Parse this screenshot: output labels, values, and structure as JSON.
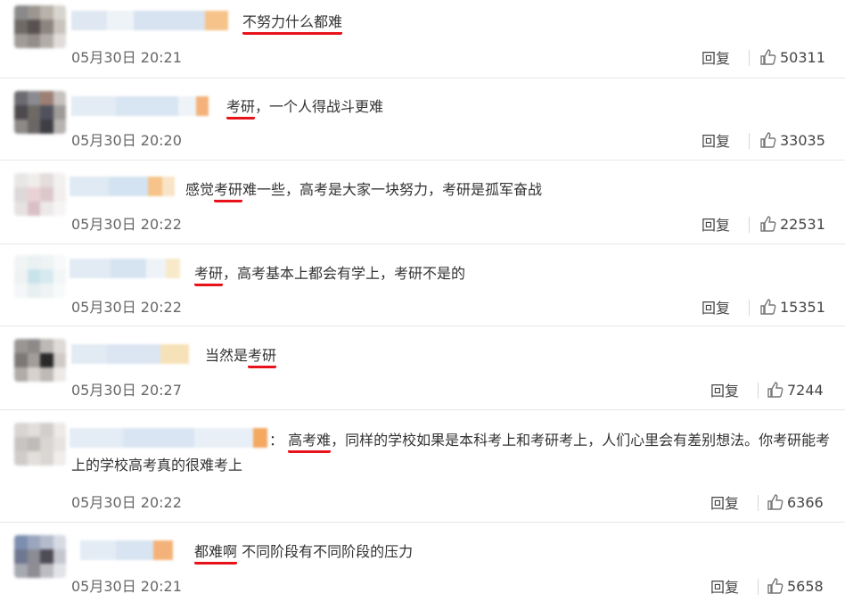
{
  "comments": [
    {
      "text_parts": [
        {
          "t": "不努力什么都难",
          "u": true
        }
      ],
      "time": "05月30日 20:21",
      "reply": "回复",
      "likes": "50311"
    },
    {
      "text_parts": [
        {
          "t": "考研",
          "u": true
        },
        {
          "t": "，一个人得战斗更难",
          "u": false
        }
      ],
      "time": "05月30日 20:20",
      "reply": "回复",
      "likes": "33035"
    },
    {
      "text_parts": [
        {
          "t": "感觉",
          "u": false
        },
        {
          "t": "考研",
          "u": true
        },
        {
          "t": "难一些，高考是大家一块努力，考研是孤军奋战",
          "u": false
        }
      ],
      "time": "05月30日 20:22",
      "reply": "回复",
      "likes": "22531"
    },
    {
      "text_parts": [
        {
          "t": "考研",
          "u": true
        },
        {
          "t": "，高考基本上都会有学上，考研不是的",
          "u": false
        }
      ],
      "time": "05月30日 20:22",
      "reply": "回复",
      "likes": "15351"
    },
    {
      "text_parts": [
        {
          "t": "当然是",
          "u": false
        },
        {
          "t": "考研",
          "u": true
        }
      ],
      "time": "05月30日 20:27",
      "reply": "回复",
      "likes": "7244"
    },
    {
      "text_parts": [
        {
          "t": "： ",
          "u": false
        },
        {
          "t": "高考难",
          "u": true
        },
        {
          "t": "，同样的学校如果是本科考上和考研考上，人们心里会有差别想法。你考研能考上的学校高考真的很难考上",
          "u": false
        }
      ],
      "time": "05月30日 20:22",
      "reply": "回复",
      "likes": "6366"
    },
    {
      "text_parts": [
        {
          "t": "都难啊",
          "u": true
        },
        {
          "t": " 不同阶段有不同阶段的压力",
          "u": false
        }
      ],
      "time": "05月30日 20:21",
      "reply": "回复",
      "likes": "5658"
    }
  ],
  "colors": {
    "underline": "#e8121b",
    "text": "#333333",
    "meta": "#666666"
  },
  "icons": {
    "like": "thumbs-up-icon"
  }
}
